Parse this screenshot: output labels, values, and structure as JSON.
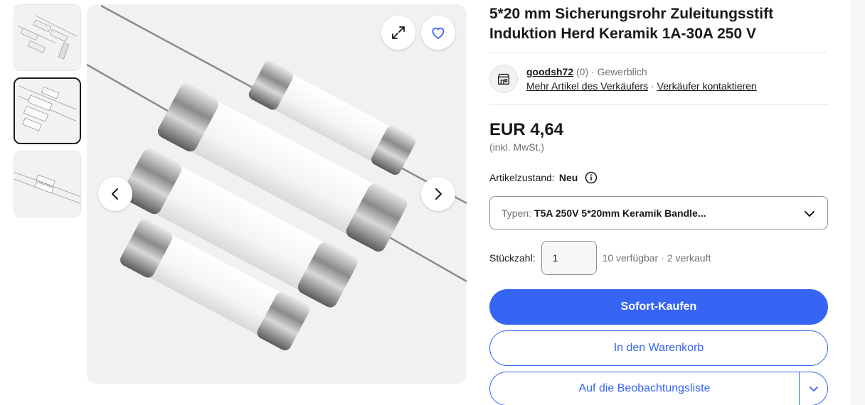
{
  "gallery": {
    "thumbnails": [
      {
        "icon": "fuse-photo-thumbnail",
        "active": false
      },
      {
        "icon": "fuse-photo-thumbnail",
        "active": true
      },
      {
        "icon": "fuse-photo-thumbnail",
        "active": false
      }
    ],
    "main_image_icon": "fuse-product-photo",
    "controls": {
      "expand_icon": "expand-icon",
      "favorite_icon": "heart-icon",
      "prev_icon": "chevron-left-icon",
      "next_icon": "chevron-right-icon"
    }
  },
  "product": {
    "title": "5*20 mm Sicherungsrohr Zuleitungsstift Induktion Herd Keramik 1A-30A 250 V"
  },
  "seller": {
    "name": "goodsh72",
    "rating": "(0)",
    "separator": "·",
    "type": "Gewerblich",
    "more_items_link": "Mehr Artikel des Verkäufers",
    "contact_link": "Verkäufer kontaktieren"
  },
  "pricing": {
    "price": "EUR 4,64",
    "vat_note": "(inkl. MwSt.)"
  },
  "condition": {
    "label": "Artikelzustand:",
    "value": "Neu"
  },
  "variant": {
    "label": "Typen:",
    "value": "T5A 250V 5*20mm Keramik Bandle..."
  },
  "quantity": {
    "label": "Stückzahl:",
    "value": "1",
    "available": "10 verfügbar",
    "separator": "·",
    "sold": "2 verkauft"
  },
  "actions": {
    "buy_now": "Sofort-Kaufen",
    "add_to_cart": "In den Warenkorb",
    "watchlist": "Auf die Beobachtungsliste"
  },
  "colors": {
    "primary": "#3665f3",
    "text": "#191919",
    "muted": "#707070"
  }
}
